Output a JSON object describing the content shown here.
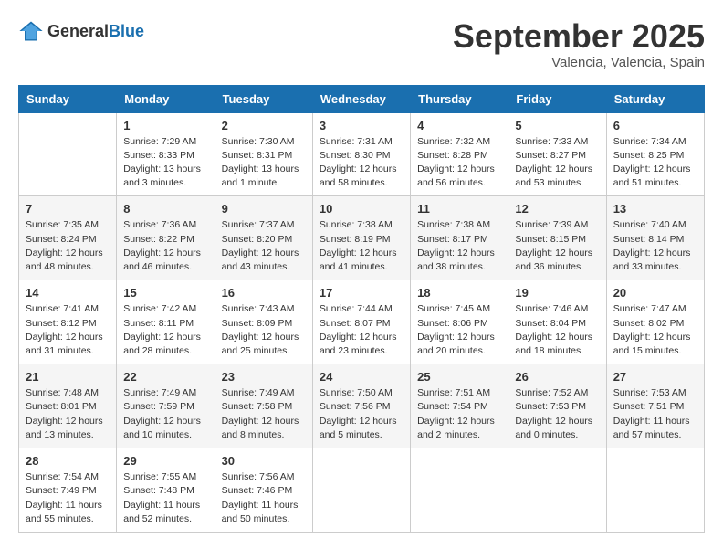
{
  "header": {
    "logo": {
      "general": "General",
      "blue": "Blue"
    },
    "title": "September 2025",
    "location": "Valencia, Valencia, Spain"
  },
  "calendar": {
    "columns": [
      "Sunday",
      "Monday",
      "Tuesday",
      "Wednesday",
      "Thursday",
      "Friday",
      "Saturday"
    ],
    "rows": [
      [
        {
          "day": "",
          "info": ""
        },
        {
          "day": "1",
          "info": "Sunrise: 7:29 AM\nSunset: 8:33 PM\nDaylight: 13 hours\nand 3 minutes."
        },
        {
          "day": "2",
          "info": "Sunrise: 7:30 AM\nSunset: 8:31 PM\nDaylight: 13 hours\nand 1 minute."
        },
        {
          "day": "3",
          "info": "Sunrise: 7:31 AM\nSunset: 8:30 PM\nDaylight: 12 hours\nand 58 minutes."
        },
        {
          "day": "4",
          "info": "Sunrise: 7:32 AM\nSunset: 8:28 PM\nDaylight: 12 hours\nand 56 minutes."
        },
        {
          "day": "5",
          "info": "Sunrise: 7:33 AM\nSunset: 8:27 PM\nDaylight: 12 hours\nand 53 minutes."
        },
        {
          "day": "6",
          "info": "Sunrise: 7:34 AM\nSunset: 8:25 PM\nDaylight: 12 hours\nand 51 minutes."
        }
      ],
      [
        {
          "day": "7",
          "info": "Sunrise: 7:35 AM\nSunset: 8:24 PM\nDaylight: 12 hours\nand 48 minutes."
        },
        {
          "day": "8",
          "info": "Sunrise: 7:36 AM\nSunset: 8:22 PM\nDaylight: 12 hours\nand 46 minutes."
        },
        {
          "day": "9",
          "info": "Sunrise: 7:37 AM\nSunset: 8:20 PM\nDaylight: 12 hours\nand 43 minutes."
        },
        {
          "day": "10",
          "info": "Sunrise: 7:38 AM\nSunset: 8:19 PM\nDaylight: 12 hours\nand 41 minutes."
        },
        {
          "day": "11",
          "info": "Sunrise: 7:38 AM\nSunset: 8:17 PM\nDaylight: 12 hours\nand 38 minutes."
        },
        {
          "day": "12",
          "info": "Sunrise: 7:39 AM\nSunset: 8:15 PM\nDaylight: 12 hours\nand 36 minutes."
        },
        {
          "day": "13",
          "info": "Sunrise: 7:40 AM\nSunset: 8:14 PM\nDaylight: 12 hours\nand 33 minutes."
        }
      ],
      [
        {
          "day": "14",
          "info": "Sunrise: 7:41 AM\nSunset: 8:12 PM\nDaylight: 12 hours\nand 31 minutes."
        },
        {
          "day": "15",
          "info": "Sunrise: 7:42 AM\nSunset: 8:11 PM\nDaylight: 12 hours\nand 28 minutes."
        },
        {
          "day": "16",
          "info": "Sunrise: 7:43 AM\nSunset: 8:09 PM\nDaylight: 12 hours\nand 25 minutes."
        },
        {
          "day": "17",
          "info": "Sunrise: 7:44 AM\nSunset: 8:07 PM\nDaylight: 12 hours\nand 23 minutes."
        },
        {
          "day": "18",
          "info": "Sunrise: 7:45 AM\nSunset: 8:06 PM\nDaylight: 12 hours\nand 20 minutes."
        },
        {
          "day": "19",
          "info": "Sunrise: 7:46 AM\nSunset: 8:04 PM\nDaylight: 12 hours\nand 18 minutes."
        },
        {
          "day": "20",
          "info": "Sunrise: 7:47 AM\nSunset: 8:02 PM\nDaylight: 12 hours\nand 15 minutes."
        }
      ],
      [
        {
          "day": "21",
          "info": "Sunrise: 7:48 AM\nSunset: 8:01 PM\nDaylight: 12 hours\nand 13 minutes."
        },
        {
          "day": "22",
          "info": "Sunrise: 7:49 AM\nSunset: 7:59 PM\nDaylight: 12 hours\nand 10 minutes."
        },
        {
          "day": "23",
          "info": "Sunrise: 7:49 AM\nSunset: 7:58 PM\nDaylight: 12 hours\nand 8 minutes."
        },
        {
          "day": "24",
          "info": "Sunrise: 7:50 AM\nSunset: 7:56 PM\nDaylight: 12 hours\nand 5 minutes."
        },
        {
          "day": "25",
          "info": "Sunrise: 7:51 AM\nSunset: 7:54 PM\nDaylight: 12 hours\nand 2 minutes."
        },
        {
          "day": "26",
          "info": "Sunrise: 7:52 AM\nSunset: 7:53 PM\nDaylight: 12 hours\nand 0 minutes."
        },
        {
          "day": "27",
          "info": "Sunrise: 7:53 AM\nSunset: 7:51 PM\nDaylight: 11 hours\nand 57 minutes."
        }
      ],
      [
        {
          "day": "28",
          "info": "Sunrise: 7:54 AM\nSunset: 7:49 PM\nDaylight: 11 hours\nand 55 minutes."
        },
        {
          "day": "29",
          "info": "Sunrise: 7:55 AM\nSunset: 7:48 PM\nDaylight: 11 hours\nand 52 minutes."
        },
        {
          "day": "30",
          "info": "Sunrise: 7:56 AM\nSunset: 7:46 PM\nDaylight: 11 hours\nand 50 minutes."
        },
        {
          "day": "",
          "info": ""
        },
        {
          "day": "",
          "info": ""
        },
        {
          "day": "",
          "info": ""
        },
        {
          "day": "",
          "info": ""
        }
      ]
    ]
  }
}
